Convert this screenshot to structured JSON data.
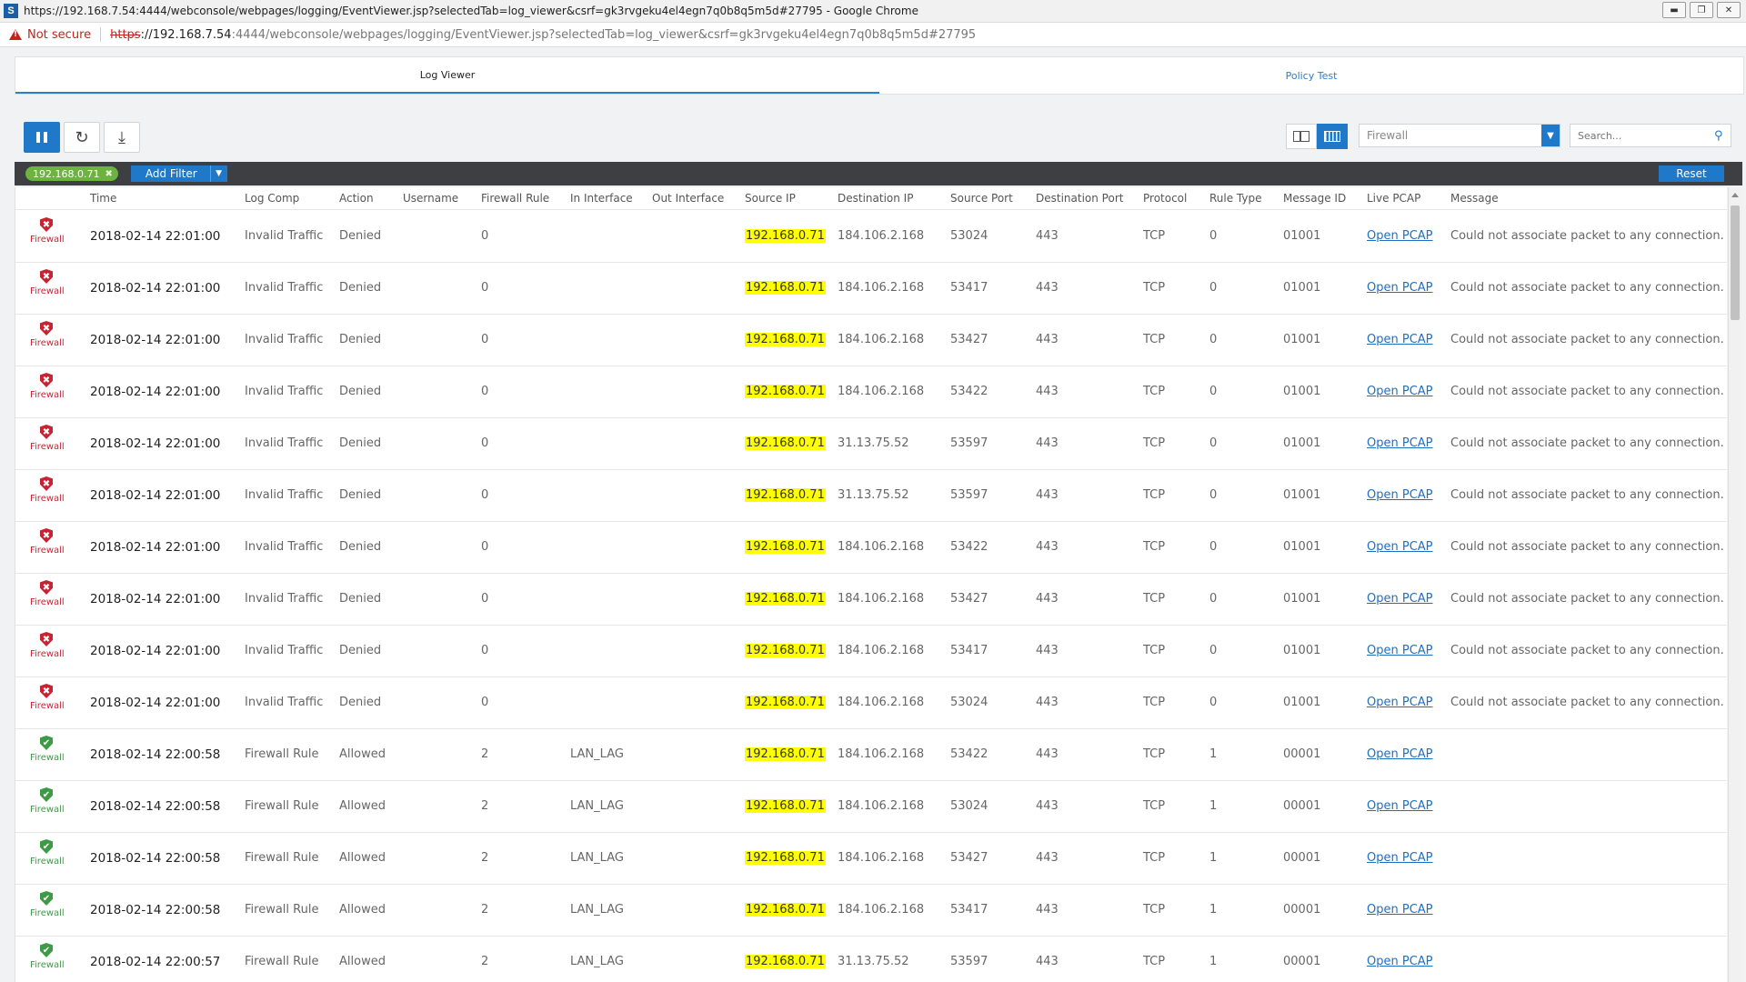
{
  "window": {
    "title": "https://192.168.7.54:4444/webconsole/webpages/logging/EventViewer.jsp?selectedTab=log_viewer&csrf=gk3rvgeku4el4egn7q0b8q5m5d#27795 - Google Chrome",
    "app_icon_letter": "S"
  },
  "address": {
    "not_secure": "Not secure",
    "scheme": "https",
    "host": "://192.168.7.54",
    "rest": ":4444/webconsole/webpages/logging/EventViewer.jsp?selectedTab=log_viewer&csrf=gk3rvgeku4el4egn7q0b8q5m5d#27795"
  },
  "tabs": [
    {
      "label": "Log Viewer",
      "active": true
    },
    {
      "label": "Policy Test",
      "active": false
    }
  ],
  "toolbar": {
    "select_value": "Firewall",
    "search_placeholder": "Search..."
  },
  "filterbar": {
    "chip": "192.168.0.71",
    "add_filter": "Add Filter",
    "reset": "Reset"
  },
  "columns": [
    "Time",
    "Log Comp",
    "Action",
    "Username",
    "Firewall Rule",
    "In Interface",
    "Out Interface",
    "Source IP",
    "Destination IP",
    "Source Port",
    "Destination Port",
    "Protocol",
    "Rule Type",
    "Message ID",
    "Live PCAP",
    "Message"
  ],
  "rows": [
    {
      "status": "denied",
      "comp": "Firewall",
      "time": "2018-02-14 22:01:00",
      "log_comp": "Invalid Traffic",
      "action": "Denied",
      "username": "",
      "fw_rule": "0",
      "in_if": "",
      "out_if": "",
      "src_ip": "192.168.0.71",
      "dst_ip": "184.106.2.168",
      "src_port": "53024",
      "dst_port": "443",
      "protocol": "TCP",
      "rule_type": "0",
      "msg_id": "01001",
      "pcap": "Open PCAP",
      "message": "Could not associate packet to any connection."
    },
    {
      "status": "denied",
      "comp": "Firewall",
      "time": "2018-02-14 22:01:00",
      "log_comp": "Invalid Traffic",
      "action": "Denied",
      "username": "",
      "fw_rule": "0",
      "in_if": "",
      "out_if": "",
      "src_ip": "192.168.0.71",
      "dst_ip": "184.106.2.168",
      "src_port": "53417",
      "dst_port": "443",
      "protocol": "TCP",
      "rule_type": "0",
      "msg_id": "01001",
      "pcap": "Open PCAP",
      "message": "Could not associate packet to any connection."
    },
    {
      "status": "denied",
      "comp": "Firewall",
      "time": "2018-02-14 22:01:00",
      "log_comp": "Invalid Traffic",
      "action": "Denied",
      "username": "",
      "fw_rule": "0",
      "in_if": "",
      "out_if": "",
      "src_ip": "192.168.0.71",
      "dst_ip": "184.106.2.168",
      "src_port": "53427",
      "dst_port": "443",
      "protocol": "TCP",
      "rule_type": "0",
      "msg_id": "01001",
      "pcap": "Open PCAP",
      "message": "Could not associate packet to any connection."
    },
    {
      "status": "denied",
      "comp": "Firewall",
      "time": "2018-02-14 22:01:00",
      "log_comp": "Invalid Traffic",
      "action": "Denied",
      "username": "",
      "fw_rule": "0",
      "in_if": "",
      "out_if": "",
      "src_ip": "192.168.0.71",
      "dst_ip": "184.106.2.168",
      "src_port": "53422",
      "dst_port": "443",
      "protocol": "TCP",
      "rule_type": "0",
      "msg_id": "01001",
      "pcap": "Open PCAP",
      "message": "Could not associate packet to any connection."
    },
    {
      "status": "denied",
      "comp": "Firewall",
      "time": "2018-02-14 22:01:00",
      "log_comp": "Invalid Traffic",
      "action": "Denied",
      "username": "",
      "fw_rule": "0",
      "in_if": "",
      "out_if": "",
      "src_ip": "192.168.0.71",
      "dst_ip": "31.13.75.52",
      "src_port": "53597",
      "dst_port": "443",
      "protocol": "TCP",
      "rule_type": "0",
      "msg_id": "01001",
      "pcap": "Open PCAP",
      "message": "Could not associate packet to any connection."
    },
    {
      "status": "denied",
      "comp": "Firewall",
      "time": "2018-02-14 22:01:00",
      "log_comp": "Invalid Traffic",
      "action": "Denied",
      "username": "",
      "fw_rule": "0",
      "in_if": "",
      "out_if": "",
      "src_ip": "192.168.0.71",
      "dst_ip": "31.13.75.52",
      "src_port": "53597",
      "dst_port": "443",
      "protocol": "TCP",
      "rule_type": "0",
      "msg_id": "01001",
      "pcap": "Open PCAP",
      "message": "Could not associate packet to any connection."
    },
    {
      "status": "denied",
      "comp": "Firewall",
      "time": "2018-02-14 22:01:00",
      "log_comp": "Invalid Traffic",
      "action": "Denied",
      "username": "",
      "fw_rule": "0",
      "in_if": "",
      "out_if": "",
      "src_ip": "192.168.0.71",
      "dst_ip": "184.106.2.168",
      "src_port": "53422",
      "dst_port": "443",
      "protocol": "TCP",
      "rule_type": "0",
      "msg_id": "01001",
      "pcap": "Open PCAP",
      "message": "Could not associate packet to any connection."
    },
    {
      "status": "denied",
      "comp": "Firewall",
      "time": "2018-02-14 22:01:00",
      "log_comp": "Invalid Traffic",
      "action": "Denied",
      "username": "",
      "fw_rule": "0",
      "in_if": "",
      "out_if": "",
      "src_ip": "192.168.0.71",
      "dst_ip": "184.106.2.168",
      "src_port": "53427",
      "dst_port": "443",
      "protocol": "TCP",
      "rule_type": "0",
      "msg_id": "01001",
      "pcap": "Open PCAP",
      "message": "Could not associate packet to any connection."
    },
    {
      "status": "denied",
      "comp": "Firewall",
      "time": "2018-02-14 22:01:00",
      "log_comp": "Invalid Traffic",
      "action": "Denied",
      "username": "",
      "fw_rule": "0",
      "in_if": "",
      "out_if": "",
      "src_ip": "192.168.0.71",
      "dst_ip": "184.106.2.168",
      "src_port": "53417",
      "dst_port": "443",
      "protocol": "TCP",
      "rule_type": "0",
      "msg_id": "01001",
      "pcap": "Open PCAP",
      "message": "Could not associate packet to any connection."
    },
    {
      "status": "denied",
      "comp": "Firewall",
      "time": "2018-02-14 22:01:00",
      "log_comp": "Invalid Traffic",
      "action": "Denied",
      "username": "",
      "fw_rule": "0",
      "in_if": "",
      "out_if": "",
      "src_ip": "192.168.0.71",
      "dst_ip": "184.106.2.168",
      "src_port": "53024",
      "dst_port": "443",
      "protocol": "TCP",
      "rule_type": "0",
      "msg_id": "01001",
      "pcap": "Open PCAP",
      "message": "Could not associate packet to any connection."
    },
    {
      "status": "allowed",
      "comp": "Firewall",
      "time": "2018-02-14 22:00:58",
      "log_comp": "Firewall Rule",
      "action": "Allowed",
      "username": "",
      "fw_rule": "2",
      "in_if": "LAN_LAG",
      "out_if": "",
      "src_ip": "192.168.0.71",
      "dst_ip": "184.106.2.168",
      "src_port": "53422",
      "dst_port": "443",
      "protocol": "TCP",
      "rule_type": "1",
      "msg_id": "00001",
      "pcap": "Open PCAP",
      "message": ""
    },
    {
      "status": "allowed",
      "comp": "Firewall",
      "time": "2018-02-14 22:00:58",
      "log_comp": "Firewall Rule",
      "action": "Allowed",
      "username": "",
      "fw_rule": "2",
      "in_if": "LAN_LAG",
      "out_if": "",
      "src_ip": "192.168.0.71",
      "dst_ip": "184.106.2.168",
      "src_port": "53024",
      "dst_port": "443",
      "protocol": "TCP",
      "rule_type": "1",
      "msg_id": "00001",
      "pcap": "Open PCAP",
      "message": ""
    },
    {
      "status": "allowed",
      "comp": "Firewall",
      "time": "2018-02-14 22:00:58",
      "log_comp": "Firewall Rule",
      "action": "Allowed",
      "username": "",
      "fw_rule": "2",
      "in_if": "LAN_LAG",
      "out_if": "",
      "src_ip": "192.168.0.71",
      "dst_ip": "184.106.2.168",
      "src_port": "53427",
      "dst_port": "443",
      "protocol": "TCP",
      "rule_type": "1",
      "msg_id": "00001",
      "pcap": "Open PCAP",
      "message": ""
    },
    {
      "status": "allowed",
      "comp": "Firewall",
      "time": "2018-02-14 22:00:58",
      "log_comp": "Firewall Rule",
      "action": "Allowed",
      "username": "",
      "fw_rule": "2",
      "in_if": "LAN_LAG",
      "out_if": "",
      "src_ip": "192.168.0.71",
      "dst_ip": "184.106.2.168",
      "src_port": "53417",
      "dst_port": "443",
      "protocol": "TCP",
      "rule_type": "1",
      "msg_id": "00001",
      "pcap": "Open PCAP",
      "message": ""
    },
    {
      "status": "allowed",
      "comp": "Firewall",
      "time": "2018-02-14 22:00:57",
      "log_comp": "Firewall Rule",
      "action": "Allowed",
      "username": "",
      "fw_rule": "2",
      "in_if": "LAN_LAG",
      "out_if": "",
      "src_ip": "192.168.0.71",
      "dst_ip": "31.13.75.52",
      "src_port": "53597",
      "dst_port": "443",
      "protocol": "TCP",
      "rule_type": "1",
      "msg_id": "00001",
      "pcap": "Open PCAP",
      "message": ""
    }
  ]
}
